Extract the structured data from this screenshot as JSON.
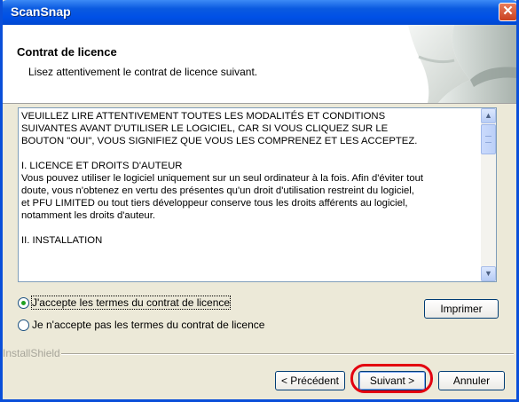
{
  "window": {
    "title": "ScanSnap",
    "close_glyph": "✕"
  },
  "header": {
    "title": "Contrat de licence",
    "subtitle": "Lisez attentivement le contrat de licence suivant."
  },
  "license": {
    "paragraphs": [
      "VEUILLEZ LIRE ATTENTIVEMENT TOUTES LES MODALITÉS ET CONDITIONS\nSUIVANTES AVANT D'UTILISER LE LOGICIEL, CAR SI VOUS CLIQUEZ SUR LE\nBOUTON \"OUI\", VOUS SIGNIFIEZ QUE VOUS LES COMPRENEZ ET LES ACCEPTEZ.",
      "I. LICENCE ET DROITS D'AUTEUR\nVous pouvez utiliser le logiciel uniquement sur un seul ordinateur à la fois. Afin d'éviter tout\ndoute, vous n'obtenez en vertu des présentes qu'un droit d'utilisation restreint du logiciel,\net PFU LIMITED ou tout tiers développeur conserve tous les droits afférents au logiciel,\nnotamment les droits d'auteur.",
      "II. INSTALLATION"
    ],
    "scroll_up_glyph": "▲",
    "scroll_down_glyph": "▼"
  },
  "options": {
    "accept_label": "J'accepte les termes du contrat de licence",
    "decline_label": "Je n'accepte pas les termes du contrat de licence",
    "selected": "accept"
  },
  "buttons": {
    "print": "Imprimer",
    "back": "< Précédent",
    "next": "Suivant >",
    "cancel": "Annuler"
  },
  "footer": {
    "brand": "InstallShield"
  },
  "colors": {
    "titlebar": "#0A5AE0",
    "dialog_bg": "#ECE9D8",
    "highlight": "#E3000F",
    "radio_dot": "#21A121"
  },
  "icons": {
    "close": "close-icon",
    "scroll_up": "scroll-up-icon",
    "scroll_down": "scroll-down-icon",
    "header_art": "wizard-banner-graphic"
  }
}
